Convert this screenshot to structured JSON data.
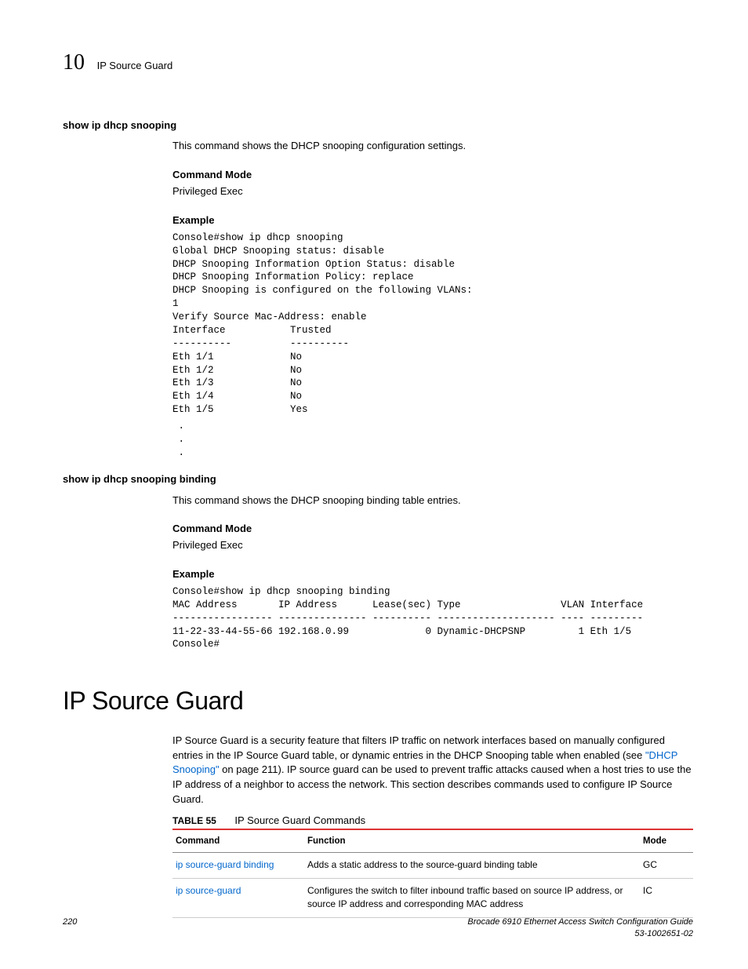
{
  "header": {
    "chapter_number": "10",
    "chapter_title": "IP Source Guard"
  },
  "sections": [
    {
      "cmd_title": "show ip dhcp snooping",
      "desc": "This command shows the DHCP snooping configuration settings.",
      "mode_h": "Command Mode",
      "mode_v": "Privileged Exec",
      "ex_h": "Example",
      "code": "Console#show ip dhcp snooping\nGlobal DHCP Snooping status: disable\nDHCP Snooping Information Option Status: disable\nDHCP Snooping Information Policy: replace\nDHCP Snooping is configured on the following VLANs:\n1\nVerify Source Mac-Address: enable\nInterface           Trusted\n----------          ----------\nEth 1/1             No\nEth 1/2             No\nEth 1/3             No\nEth 1/4             No\nEth 1/5             Yes",
      "dots": " .\n .\n ."
    },
    {
      "cmd_title": "show ip dhcp snooping binding",
      "desc": "This command shows the DHCP snooping binding table entries.",
      "mode_h": "Command Mode",
      "mode_v": "Privileged Exec",
      "ex_h": "Example",
      "code": "Console#show ip dhcp snooping binding\nMAC Address       IP Address      Lease(sec) Type                 VLAN Interface\n----------------- --------------- ---------- -------------------- ---- ---------\n11-22-33-44-55-66 192.168.0.99             0 Dynamic-DHCPSNP         1 Eth 1/5\nConsole#"
    }
  ],
  "main_section": {
    "title": "IP Source Guard",
    "para_pre": "IP Source Guard is a security feature that filters IP traffic on network interfaces based on manually configured entries in the IP Source Guard table, or dynamic entries in the DHCP Snooping table when enabled (see ",
    "link_text": "\"DHCP Snooping\"",
    "para_post": " on page 211). IP source guard can be used to prevent traffic attacks caused when a host tries to use the IP address of a neighbor to access the network. This section describes commands used to configure IP Source Guard."
  },
  "table": {
    "label": "TABLE 55",
    "caption": "IP Source Guard Commands",
    "headers": {
      "c1": "Command",
      "c2": "Function",
      "c3": "Mode"
    },
    "rows": [
      {
        "cmd": "ip source-guard binding",
        "func": "Adds a static address to the source-guard binding table",
        "mode": "GC"
      },
      {
        "cmd": "ip source-guard",
        "func": "Configures the switch to filter inbound traffic based on source IP address, or source IP address and corresponding MAC address",
        "mode": "IC"
      }
    ]
  },
  "footer": {
    "page": "220",
    "doc1": "Brocade 6910 Ethernet Access Switch Configuration Guide",
    "doc2": "53-1002651-02"
  }
}
